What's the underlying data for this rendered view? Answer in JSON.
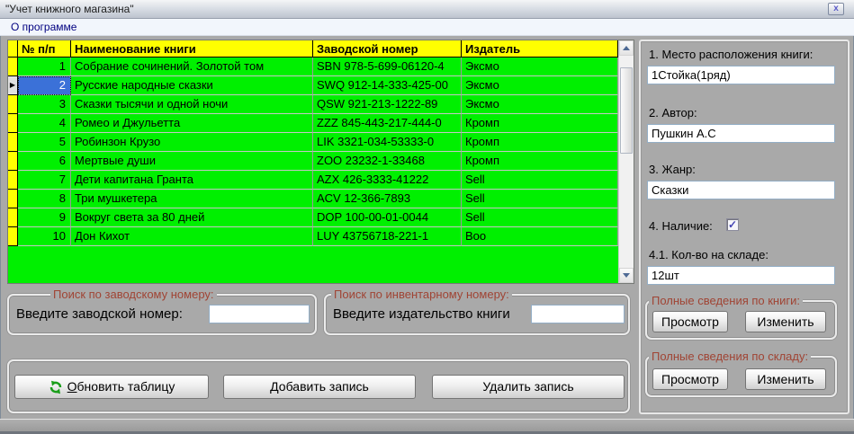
{
  "window": {
    "title": "\"Учет книжного магазина\"",
    "close_label": "x"
  },
  "menu": {
    "about": "О программе"
  },
  "grid": {
    "header": {
      "num": "№ п/п",
      "name": "Наименование книги",
      "serial": "Заводской номер",
      "publisher": "Издатель"
    },
    "selected_row_index": 1,
    "rows": [
      {
        "num": "1",
        "name": "Собрание сочинений. Золотой том",
        "serial": "SBN 978-5-699-06120-4",
        "publisher": "Эксмо"
      },
      {
        "num": "2",
        "name": "Русские народные сказки",
        "serial": "SWQ 912-14-333-425-00",
        "publisher": "Эксмо"
      },
      {
        "num": "3",
        "name": "Сказки тысячи и одной ночи",
        "serial": "QSW 921-213-1222-89",
        "publisher": "Эксмо"
      },
      {
        "num": "4",
        "name": "Ромео и Джульетта",
        "serial": "ZZZ 845-443-217-444-0",
        "publisher": "Кромп"
      },
      {
        "num": "5",
        "name": "Робинзон Крузо",
        "serial": "LIK 3321-034-53333-0",
        "publisher": "Кромп"
      },
      {
        "num": "6",
        "name": "Мертвые души",
        "serial": "ZOO 23232-1-33468",
        "publisher": "Кромп"
      },
      {
        "num": "7",
        "name": "Дети капитана Гранта",
        "serial": "AZX 426-3333-41222",
        "publisher": "Sell"
      },
      {
        "num": "8",
        "name": "Три мушкетера",
        "serial": "ACV 12-366-7893",
        "publisher": "Sell"
      },
      {
        "num": "9",
        "name": "Вокруг света за 80 дней",
        "serial": "DOP 100-00-01-0044",
        "publisher": "Sell"
      },
      {
        "num": "10",
        "name": "Дон Кихот",
        "serial": "LUY 43756718-221-1",
        "publisher": "Boo"
      }
    ]
  },
  "search_serial": {
    "title": "Поиск по заводскому номеру:",
    "label": "Введите заводской номер:",
    "value": ""
  },
  "search_inventory": {
    "title": "Поиск по инвентарному номеру:",
    "label": "Введите издательство книги",
    "value": ""
  },
  "actions": {
    "refresh_accel": "О",
    "refresh_rest": "бновить таблицу",
    "add": "Добавить запись",
    "delete": "Удалить запись"
  },
  "details": {
    "location_label": "1. Место расположения книги:",
    "location_value": "1Стойка(1ряд)",
    "author_label": "2. Автор:",
    "author_value": "Пушкин А.С",
    "genre_label": "3. Жанр:",
    "genre_value": "Сказки",
    "availability_label": "4. Наличие:",
    "availability_checked": true,
    "stock_label": "4.1. Кол-во на складе:",
    "stock_value": "12шт",
    "book_group": {
      "title": "Полные сведения по книги:",
      "view": "Просмотр",
      "edit": "Изменить"
    },
    "stock_group": {
      "title": "Полные сведения по складу:",
      "view": "Просмотр",
      "edit": "Изменить"
    }
  },
  "colors": {
    "grid_row_bg": "#00F000",
    "grid_header_bg": "#FFFF00",
    "selection_bg": "#3B71D8",
    "group_title_text": "#A04434",
    "menu_text": "#000080",
    "panel_bg": "#A9A9A9"
  }
}
